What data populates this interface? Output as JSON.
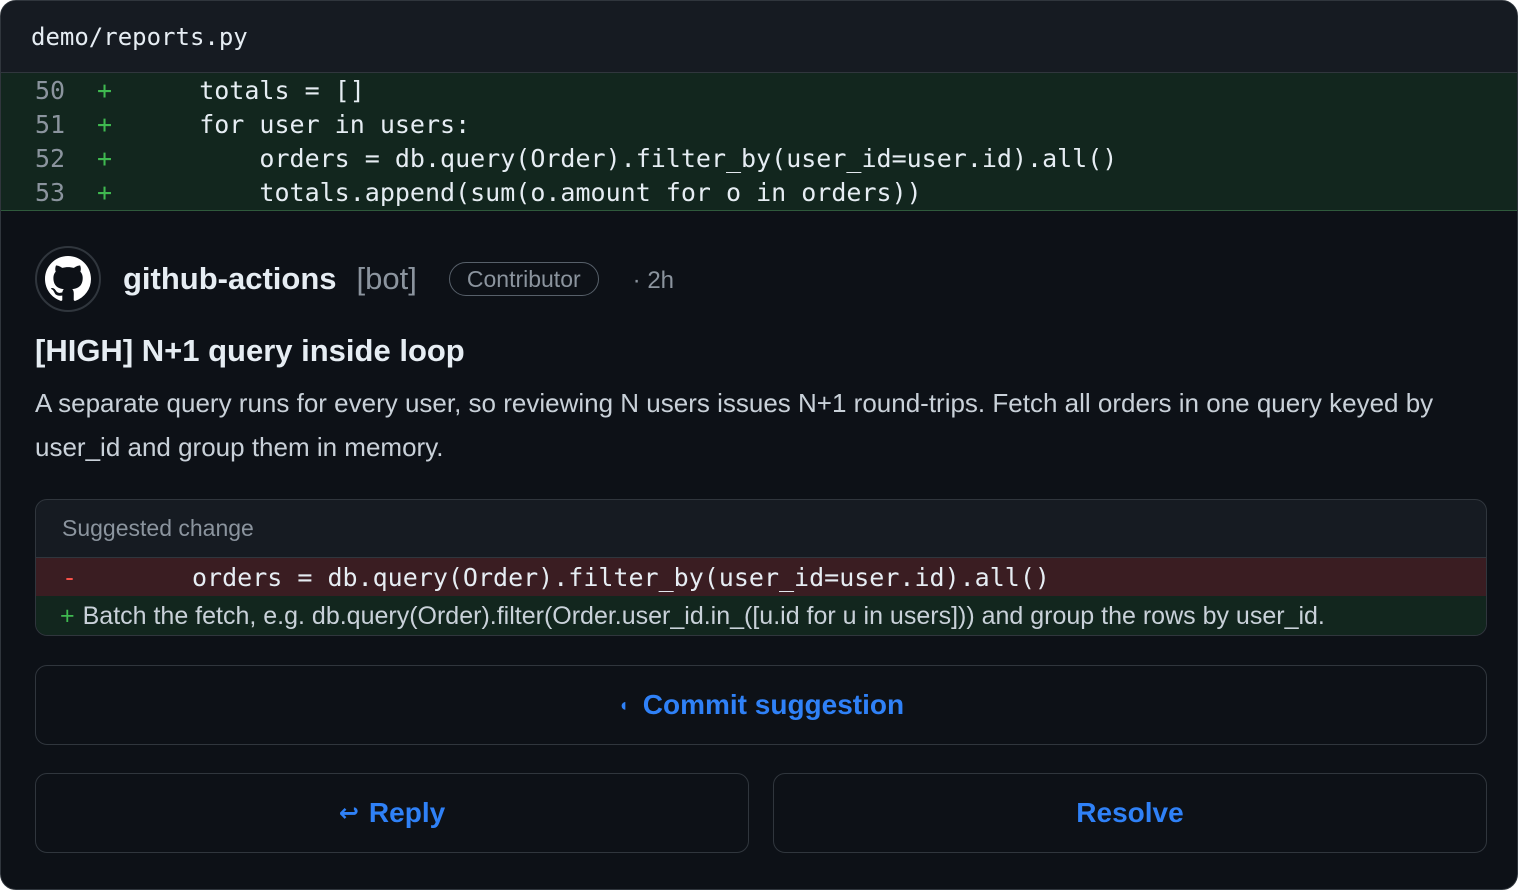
{
  "file": {
    "path": "demo/reports.py"
  },
  "diff": {
    "lines": [
      {
        "num": "50",
        "sign": "+",
        "code": "    totals = []"
      },
      {
        "num": "51",
        "sign": "+",
        "code": "    for user in users:"
      },
      {
        "num": "52",
        "sign": "+",
        "code": "        orders = db.query(Order).filter_by(user_id=user.id).all()"
      },
      {
        "num": "53",
        "sign": "+",
        "code": "        totals.append(sum(o.amount for o in orders))"
      }
    ]
  },
  "comment": {
    "author": "github-actions",
    "bot_tag": "[bot]",
    "badge": "Contributor",
    "time": "· 2h",
    "avatar_icon": "github-mark-icon",
    "title": "[HIGH] N+1 query inside loop",
    "body": "A separate query runs for every user, so reviewing N users issues N+1 round-trips. Fetch all orders in one query keyed by user_id and group them in memory."
  },
  "suggestion": {
    "header": "Suggested change",
    "removed": {
      "sign": "-",
      "code": "orders = db.query(Order).filter_by(user_id=user.id).all()"
    },
    "added": {
      "sign": "+",
      "text": "Batch the fetch, e.g. db.query(Order).filter(Order.user_id.in_([u.id for u in users])) and group the rows by user_id."
    }
  },
  "actions": {
    "commit_label": "Commit suggestion",
    "commit_icon": "commit-icon",
    "reply_label": "Reply",
    "reply_icon": "reply-arrow-icon",
    "resolve_label": "Resolve"
  },
  "colors": {
    "accent": "#2f81f7",
    "added_bg": "#12261e",
    "removed_bg": "#3a1d22",
    "background": "#0d1117"
  }
}
